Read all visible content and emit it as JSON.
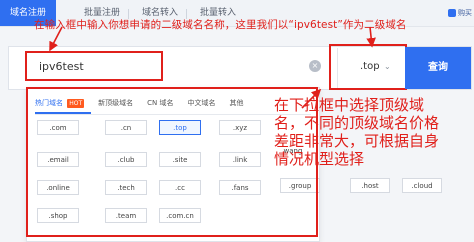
{
  "tabs": [
    {
      "label": "域名注册",
      "active": true
    },
    {
      "label": "批量注册",
      "active": false
    },
    {
      "label": "域名转入",
      "active": false
    },
    {
      "label": "批量转入",
      "active": false
    }
  ],
  "topright_label": "购买",
  "annotation_top": "在输入框中输入你想申请的二级域名名称，这里我们以“ipv6test”作为二级域名",
  "search": {
    "value": "ipv6test",
    "tld_value": ".top",
    "button_label": "查询"
  },
  "categories": [
    "热门域名",
    "新顶级域名",
    "CN 域名",
    "中文域名",
    "其他"
  ],
  "hot_badge": "HOT",
  "tld_grid": [
    [
      ".com",
      ".cn",
      ".top",
      ".xyz",
      ""
    ],
    [
      ".email",
      ".club",
      ".site",
      ".link",
      ""
    ],
    [
      ".online",
      ".tech",
      ".cc",
      ".fans",
      ""
    ],
    [
      ".shop",
      ".team",
      ".com.cn",
      "",
      ""
    ]
  ],
  "tld_grid_right": [
    {
      "label": "wang",
      "row": 1
    },
    {
      "label": ".group",
      "row": 2
    },
    {
      "label": ".host",
      "row": 2
    },
    {
      "label": ".cloud",
      "row": 2
    }
  ],
  "annotation_right": "在下拉框中选择顶级域名，不同的顶级域名价格差距非常大，可根据自身情况机型选择",
  "colors": {
    "accent": "#2f6ff0",
    "annotation_red": "#e0201b",
    "hot": "#ff5a1f"
  }
}
